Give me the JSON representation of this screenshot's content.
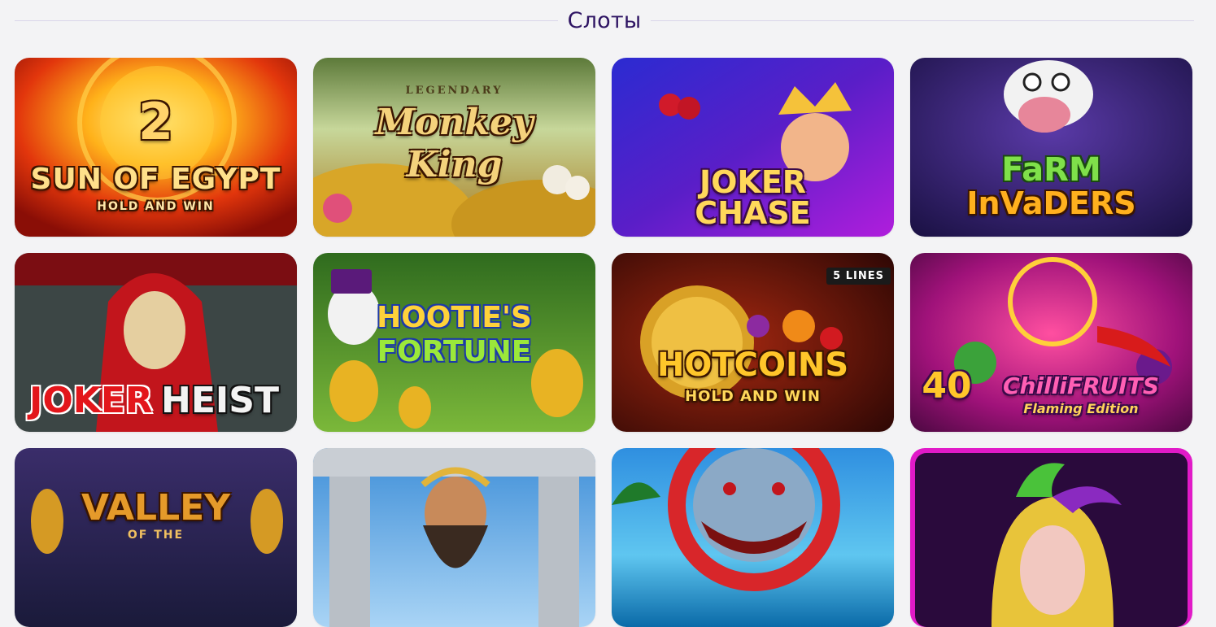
{
  "section": {
    "title": "Слоты"
  },
  "games": [
    {
      "id": "sun-of-egypt-2",
      "lines": [
        "2",
        "SUN OF EGYPT",
        "HOLD AND WIN"
      ]
    },
    {
      "id": "legendary-monkey-king",
      "lines": [
        "LEGENDARY",
        "Monkey",
        "King"
      ]
    },
    {
      "id": "joker-chase",
      "lines": [
        "JOKER",
        "CHASE"
      ]
    },
    {
      "id": "farm-invaders",
      "lines": [
        "FaRM",
        "InVaDERS"
      ]
    },
    {
      "id": "joker-heist",
      "lines": [
        "JOKER",
        "HEIST"
      ]
    },
    {
      "id": "hooties-fortune",
      "lines": [
        "HOOTIE'S",
        "FORTUNE"
      ]
    },
    {
      "id": "hot-coins",
      "lines": [
        "HOTCOINS",
        "HOLD AND WIN"
      ],
      "badge": "5 LINES"
    },
    {
      "id": "40-chilli-fruits",
      "lines": [
        "40",
        "ChilliFRUITS",
        "Flaming Edition"
      ]
    },
    {
      "id": "valley-of-the-gods",
      "lines": [
        "VALLEY",
        "OF THE"
      ]
    },
    {
      "id": "zeus",
      "lines": []
    },
    {
      "id": "shark",
      "lines": []
    },
    {
      "id": "jester",
      "lines": []
    }
  ],
  "colors": {
    "accent": "#2e1463",
    "page_bg": "#f3f3f5",
    "rule": "#d9d6ea"
  }
}
